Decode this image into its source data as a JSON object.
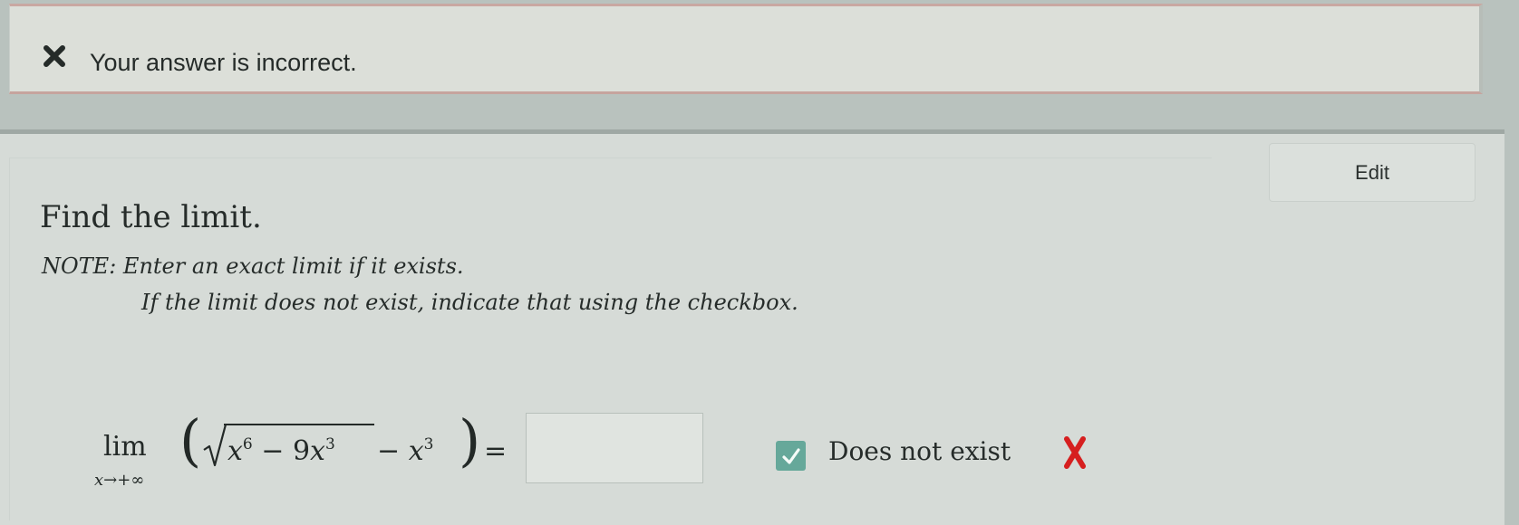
{
  "feedback": {
    "icon": "x-icon",
    "message": "Your answer is incorrect.",
    "status_color": "#b8453f"
  },
  "question": {
    "edit_label": "Edit",
    "title": "Find the limit.",
    "note_line_1": "NOTE: Enter an exact limit if it exists.",
    "note_line_2": "If the limit does not exist, indicate that using the checkbox."
  },
  "expression": {
    "lim": "lim",
    "subscript": "x→+∞",
    "paren_left": "(",
    "radicand_a_base": "x",
    "radicand_a_exp": "6",
    "radicand_op": " − 9",
    "radicand_b_base": "x",
    "radicand_b_exp": "3",
    "minus_term_op": "− ",
    "minus_term_base": "x",
    "minus_term_exp": "3",
    "paren_right": ")",
    "equals": "="
  },
  "answer": {
    "input_value": "",
    "does_not_exist_label": "Does not exist",
    "checkbox_checked": true,
    "checkbox_color": "#66a89a",
    "result_icon": "red-x-icon",
    "result_color": "#d61f1f"
  }
}
